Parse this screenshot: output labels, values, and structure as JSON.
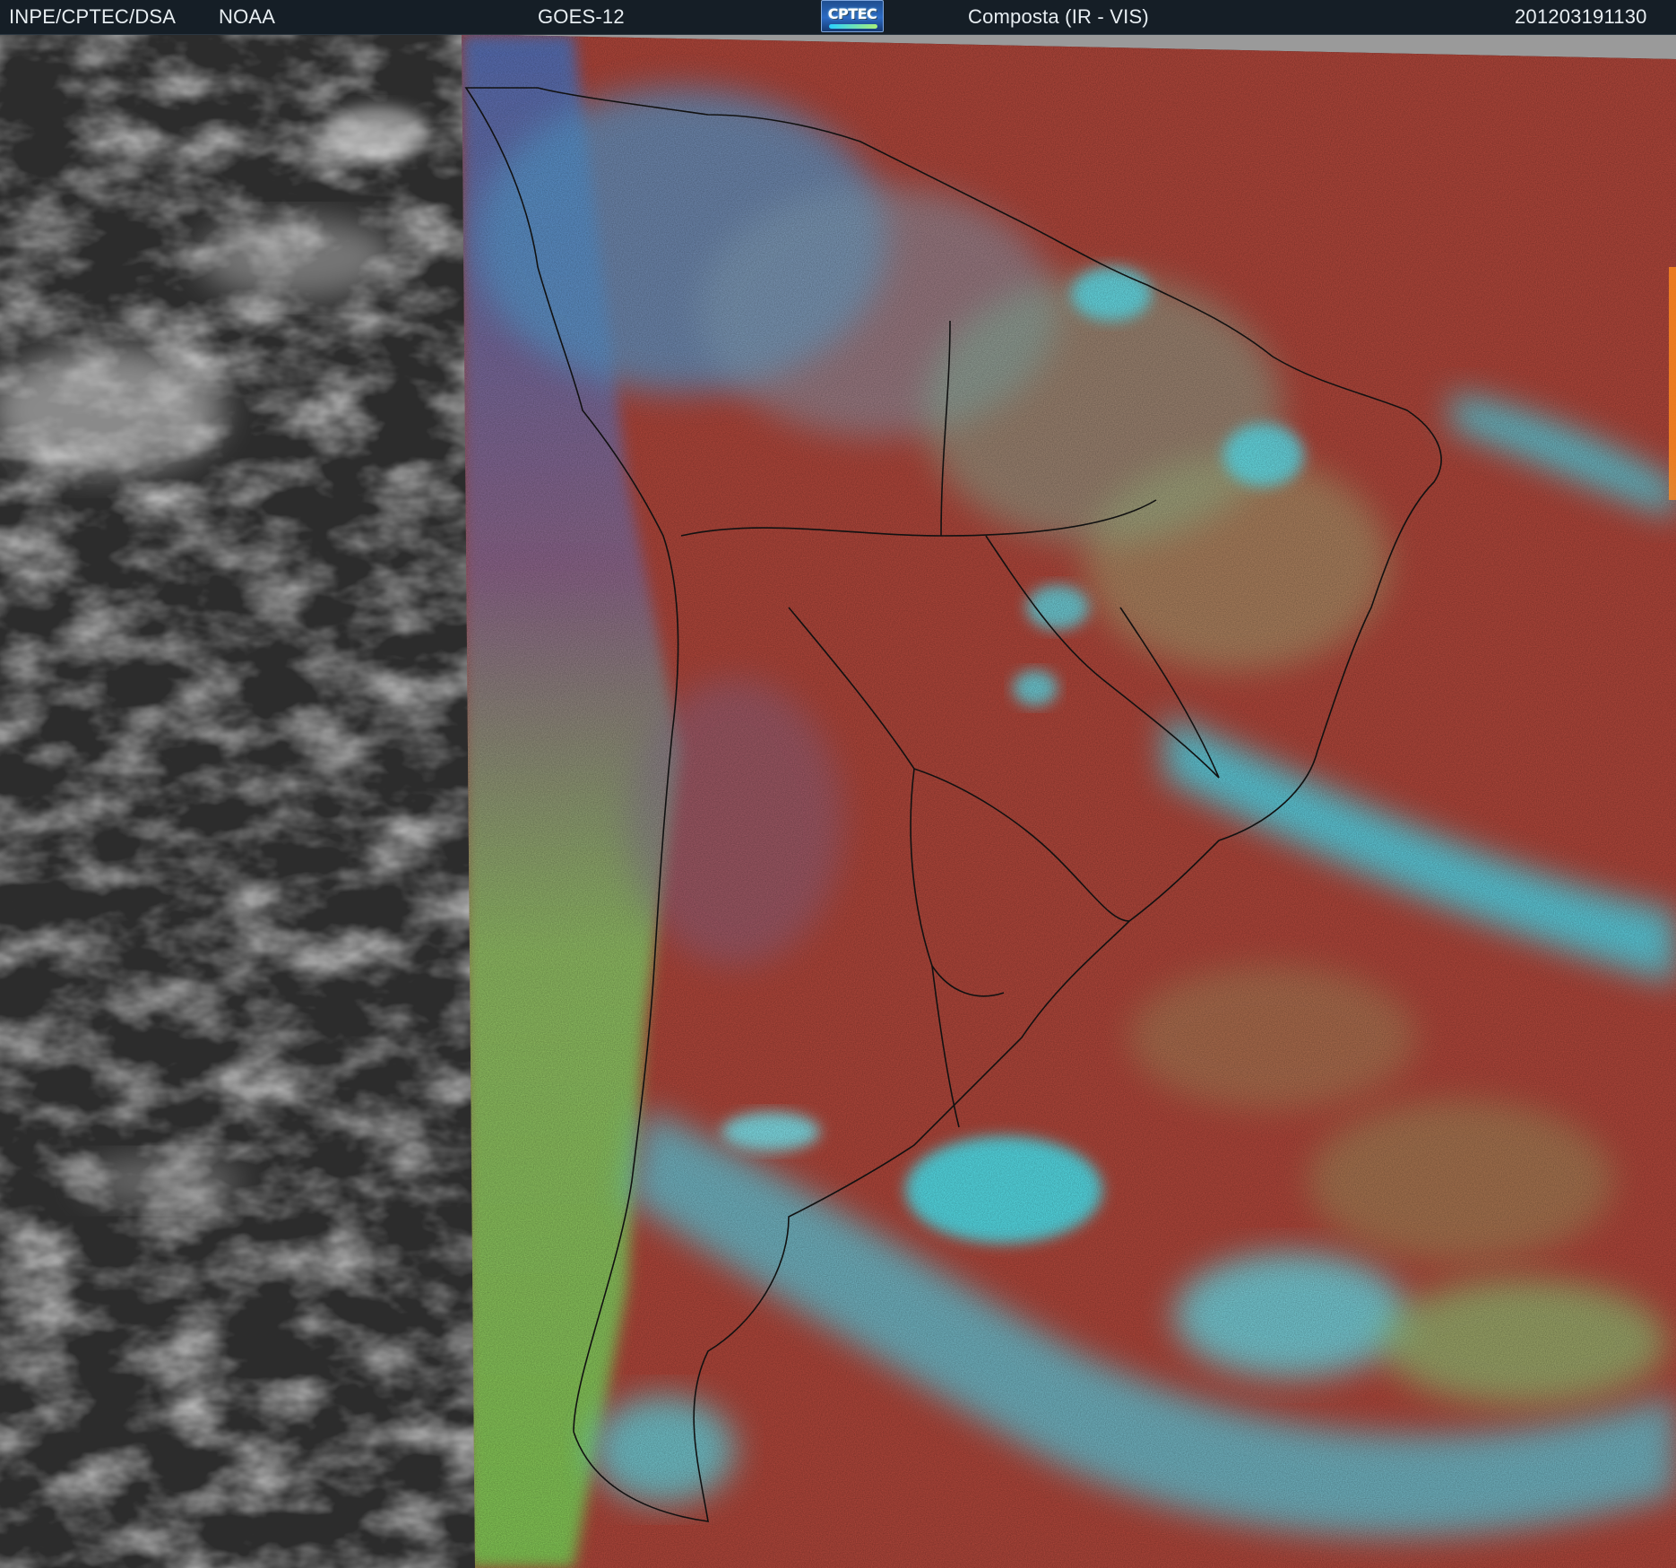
{
  "header": {
    "left_org": "INPE/CPTEC/DSA",
    "left_agency": "NOAA",
    "satellite": "GOES-12",
    "logo_text": "CPTEC",
    "product": "Composta (IR - VIS)",
    "timestamp": "201203191130"
  },
  "imagery": {
    "ocean_color": "#b5483c",
    "cloud_high_color": "#3ff3ff",
    "cloud_mid_color": "#7fe77a",
    "ir_grey_color": "#2e2e2e",
    "boundary_color": "#111111"
  }
}
